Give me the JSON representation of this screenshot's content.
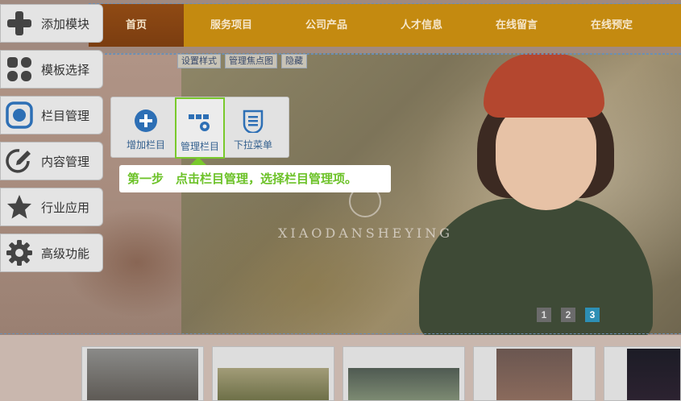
{
  "nav": {
    "items": [
      {
        "label": "首页",
        "active": true
      },
      {
        "label": "服务项目",
        "active": false
      },
      {
        "label": "公司产品",
        "active": false
      },
      {
        "label": "人才信息",
        "active": false
      },
      {
        "label": "在线留言",
        "active": false
      },
      {
        "label": "在线预定",
        "active": false
      }
    ]
  },
  "edit_tags": [
    "设置样式",
    "管理焦点图",
    "隐藏"
  ],
  "sidebar": {
    "items": [
      {
        "label": "添加模块",
        "icon": "plus-icon"
      },
      {
        "label": "模板选择",
        "icon": "grid-icon"
      },
      {
        "label": "栏目管理",
        "icon": "column-icon",
        "selected": true
      },
      {
        "label": "内容管理",
        "icon": "edit-icon"
      },
      {
        "label": "行业应用",
        "icon": "star-icon"
      },
      {
        "label": "高级功能",
        "icon": "gear-icon"
      }
    ]
  },
  "submenu": {
    "items": [
      {
        "label": "增加栏目",
        "icon": "add-circle-icon"
      },
      {
        "label": "管理栏目",
        "icon": "manage-columns-icon",
        "highlight": true
      },
      {
        "label": "下拉菜单",
        "icon": "dropdown-menu-icon"
      }
    ]
  },
  "tip": {
    "text": "第一步　点击栏目管理，选择栏目管理项。"
  },
  "hero": {
    "watermark": "XIAODANSHEYING"
  },
  "pagination": {
    "pages": [
      "1",
      "2",
      "3"
    ],
    "current": "3"
  },
  "colors": {
    "nav_bg": "#c48a10",
    "nav_active": "#8d4b12",
    "tip_text": "#6cc228",
    "highlight_border": "#79c92c",
    "pagination_active": "#2d8fb5",
    "icon_blue": "#2d6fb5"
  }
}
